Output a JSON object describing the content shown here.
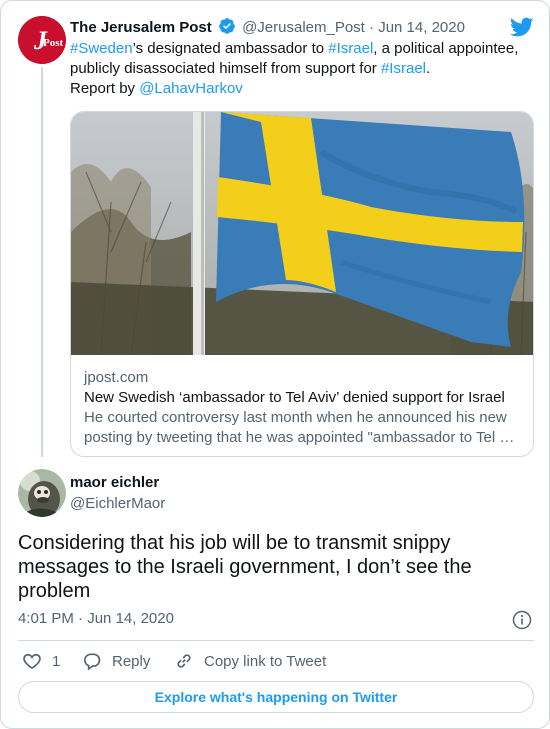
{
  "parent_tweet": {
    "avatar_text": "JPost",
    "author_name": "The Jerusalem Post",
    "author_handle": "@Jerusalem_Post",
    "separator": "·",
    "date": "Jun 14, 2020",
    "text_parts": {
      "hashtag_sweden": "#Sweden",
      "t1": "’s designated ambassador to ",
      "hashtag_israel_1": "#Israel",
      "t2": ", a political appointee, publicly disassociated himself from support for ",
      "hashtag_israel_2": "#Israel",
      "t3": ".",
      "report_by": "Report by ",
      "reporter": "@LahavHarkov"
    },
    "link_card": {
      "domain": "jpost.com",
      "title": "New Swedish ‘ambassador to Tel Aviv’ denied support for Israel",
      "description": "He courted controversy last month when he announced his new posting by tweeting that he was appointed \"ambassador to Tel …"
    }
  },
  "reply_tweet": {
    "author_name": "maor eichler",
    "author_handle": "@EichlerMaor",
    "text": "Considering that his job will be to transmit snippy messages to the Israeli government, I don’t see the problem",
    "time": "4:01 PM",
    "separator": "·",
    "date": "Jun 14, 2020",
    "likes": "1",
    "reply_label": "Reply",
    "copy_link_label": "Copy link to Tweet"
  },
  "explore_label": "Explore what's happening on Twitter",
  "icons": {
    "brand": "twitter-bird-icon",
    "verified": "verified-badge-icon",
    "info": "info-icon",
    "like": "heart-icon",
    "reply": "reply-bubble-icon",
    "copy_link": "link-icon"
  },
  "colors": {
    "accent": "#1d9bf0",
    "brand_red": "#c8102e",
    "text": "#0f1419",
    "muted": "#536471",
    "border": "#cfd9de"
  }
}
